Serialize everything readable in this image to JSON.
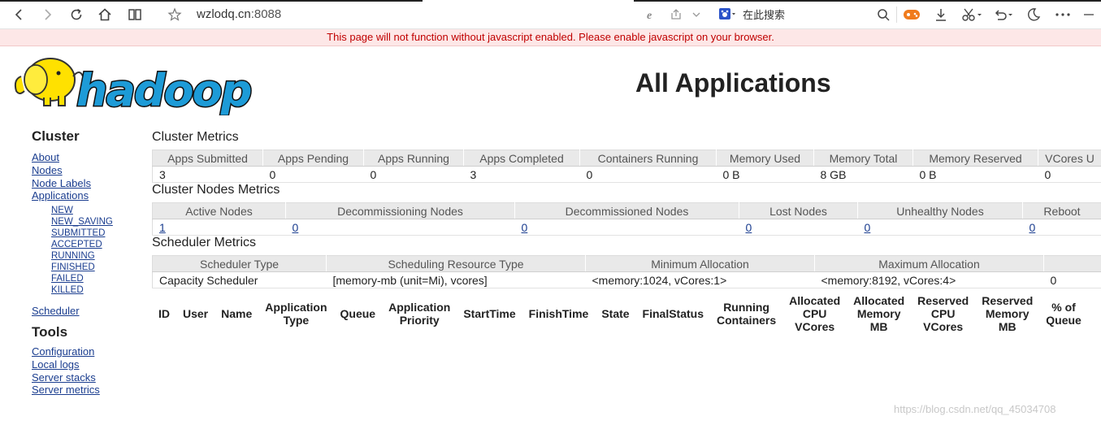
{
  "browser": {
    "url_host": "wzlodq.cn",
    "url_port": ":8088",
    "search_placeholder": "在此搜索"
  },
  "banner": {
    "text": "This page will not function without javascript enabled. Please enable javascript on your browser."
  },
  "header": {
    "logo_text": "hadoop",
    "title": "All Applications"
  },
  "nav": {
    "cluster_heading": "Cluster",
    "cluster_links": [
      "About",
      "Nodes",
      "Node Labels",
      "Applications"
    ],
    "app_states": [
      "NEW",
      "NEW_SAVING",
      "SUBMITTED",
      "ACCEPTED",
      "RUNNING",
      "FINISHED",
      "FAILED",
      "KILLED"
    ],
    "scheduler_link": "Scheduler",
    "tools_heading": "Tools",
    "tools_links": [
      "Configuration",
      "Local logs",
      "Server stacks",
      "Server metrics"
    ]
  },
  "cluster_metrics": {
    "title": "Cluster Metrics",
    "headers": [
      "Apps Submitted",
      "Apps Pending",
      "Apps Running",
      "Apps Completed",
      "Containers Running",
      "Memory Used",
      "Memory Total",
      "Memory Reserved",
      "VCores U"
    ],
    "values": [
      "3",
      "0",
      "0",
      "3",
      "0",
      "0 B",
      "8 GB",
      "0 B",
      "0"
    ]
  },
  "nodes_metrics": {
    "title": "Cluster Nodes Metrics",
    "headers": [
      "Active Nodes",
      "Decommissioning Nodes",
      "Decommissioned Nodes",
      "Lost Nodes",
      "Unhealthy Nodes",
      "Reboot"
    ],
    "values": [
      "1",
      "0",
      "0",
      "0",
      "0",
      "0"
    ]
  },
  "scheduler_metrics": {
    "title": "Scheduler Metrics",
    "headers": [
      "Scheduler Type",
      "Scheduling Resource Type",
      "Minimum Allocation",
      "Maximum Allocation",
      ""
    ],
    "values": [
      "Capacity Scheduler",
      "[memory-mb (unit=Mi), vcores]",
      "<memory:1024, vCores:1>",
      "<memory:8192, vCores:4>",
      "0"
    ]
  },
  "apps_table": {
    "headers": [
      [
        "ID"
      ],
      [
        "User"
      ],
      [
        "Name"
      ],
      [
        "Application",
        "Type"
      ],
      [
        "Queue"
      ],
      [
        "Application",
        "Priority"
      ],
      [
        "StartTime"
      ],
      [
        "FinishTime"
      ],
      [
        "State"
      ],
      [
        "FinalStatus"
      ],
      [
        "Running",
        "Containers"
      ],
      [
        "Allocated",
        "CPU",
        "VCores"
      ],
      [
        "Allocated",
        "Memory",
        "MB"
      ],
      [
        "Reserved",
        "CPU",
        "VCores"
      ],
      [
        "Reserved",
        "Memory",
        "MB"
      ],
      [
        "% of",
        "Queue"
      ]
    ]
  },
  "watermark": "https://blog.csdn.net/qq_45034708",
  "colors": {
    "link": "#1a3d8f",
    "banner_text": "#c00000",
    "banner_bg": "#fde7e7",
    "table_header_bg": "#e9e9e9"
  }
}
